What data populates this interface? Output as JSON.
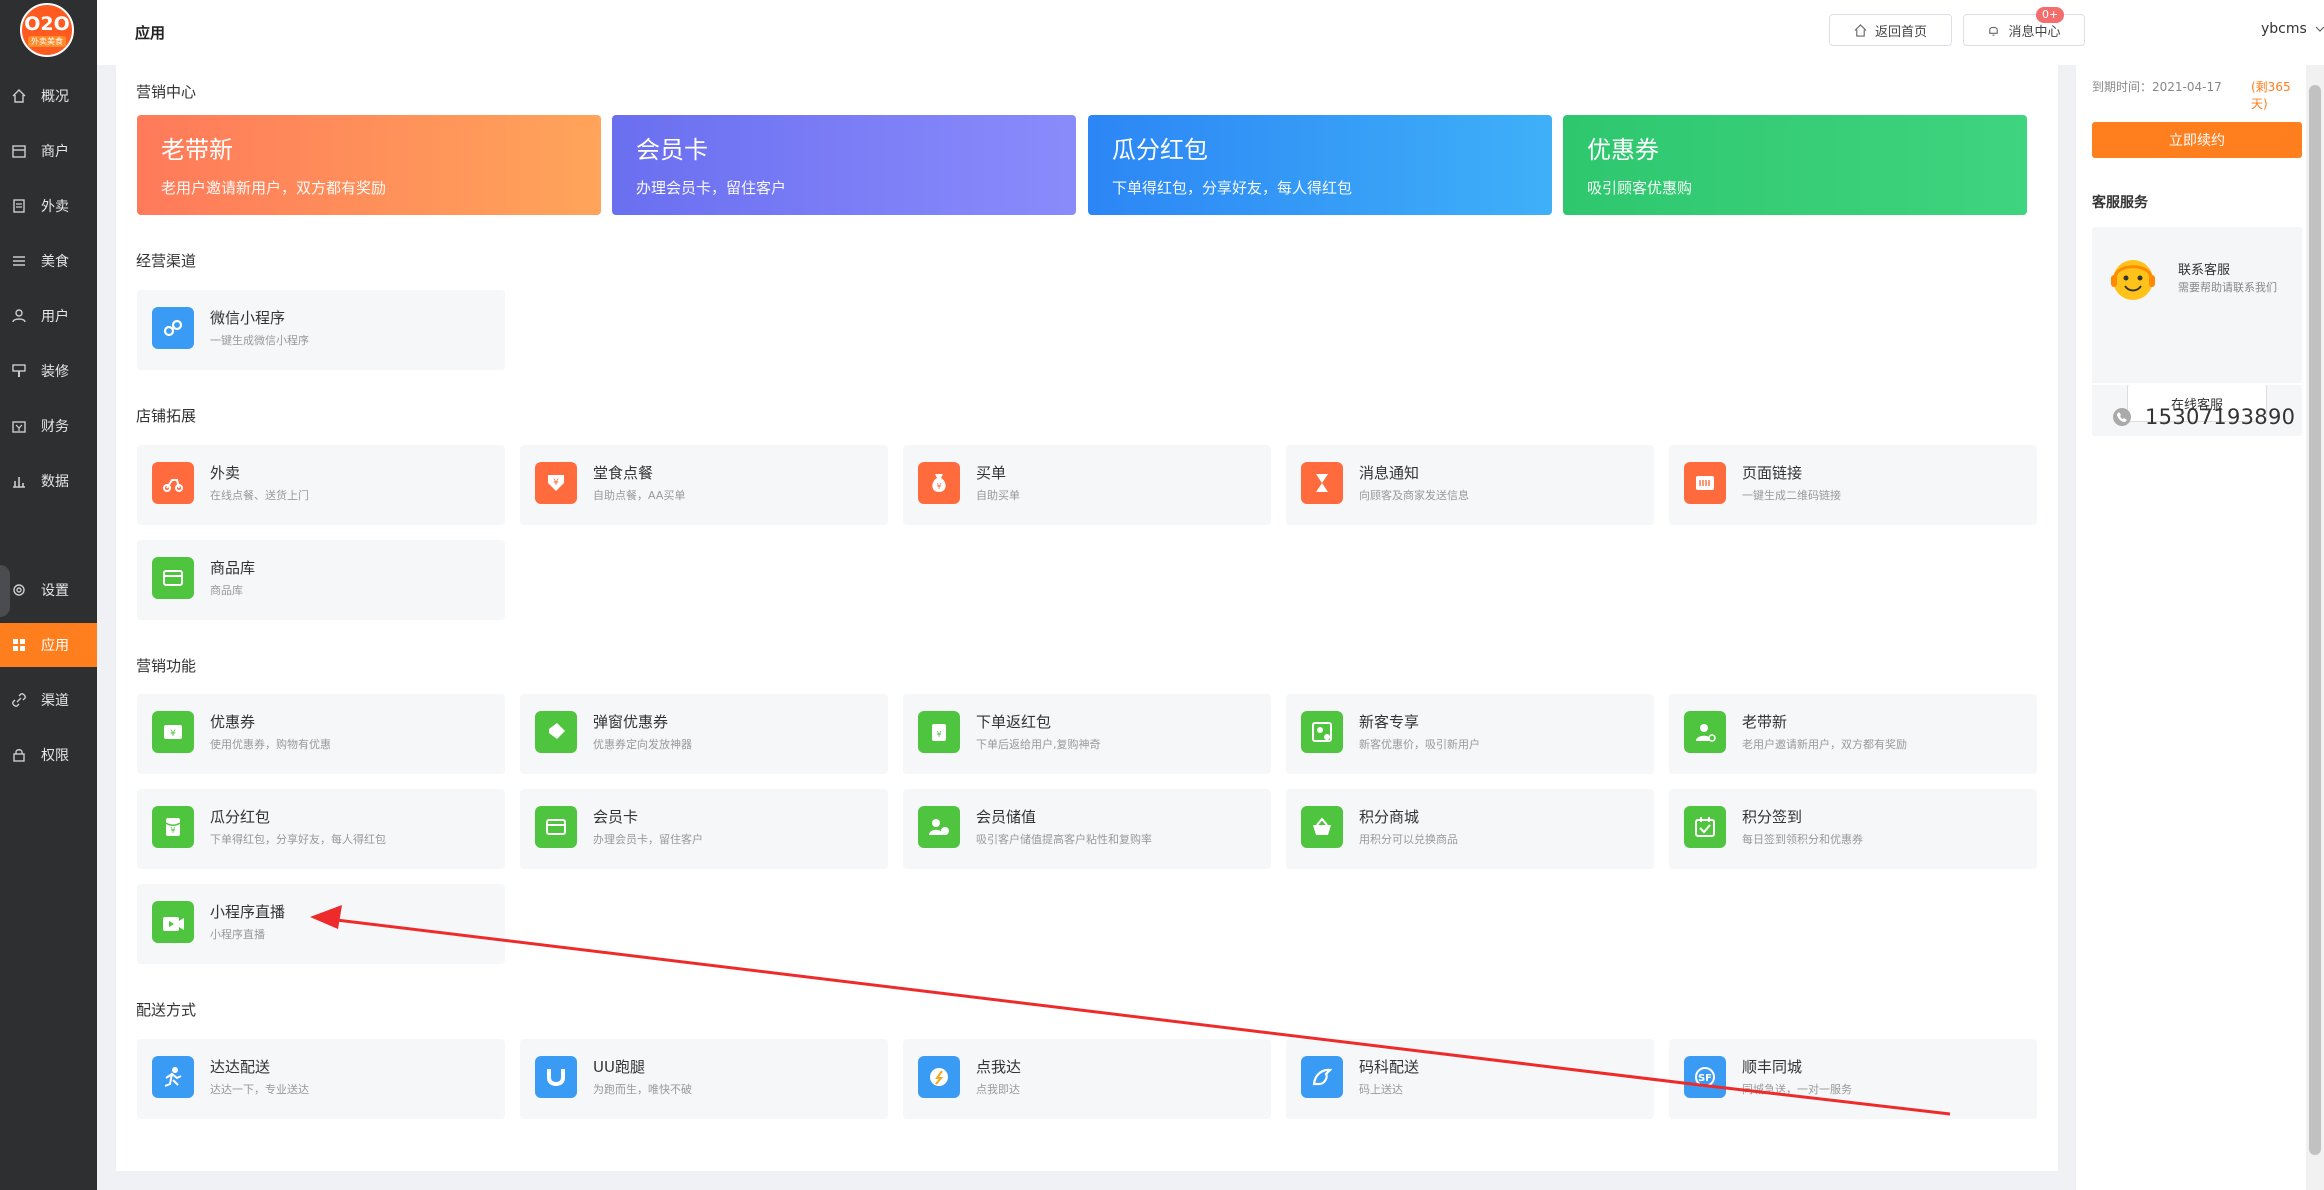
{
  "logo": {
    "text": "O2O",
    "sub": "外卖美食"
  },
  "sidebar": {
    "items": [
      {
        "label": "概况",
        "icon": "home-icon"
      },
      {
        "label": "商户",
        "icon": "store-icon"
      },
      {
        "label": "外卖",
        "icon": "document-icon"
      },
      {
        "label": "美食",
        "icon": "list-icon"
      },
      {
        "label": "用户",
        "icon": "user-icon"
      },
      {
        "label": "装修",
        "icon": "paint-icon"
      },
      {
        "label": "财务",
        "icon": "wallet-icon"
      },
      {
        "label": "数据",
        "icon": "bar-chart-icon"
      },
      {
        "label": "设置",
        "icon": "gear-icon"
      },
      {
        "label": "应用",
        "icon": "apps-icon"
      },
      {
        "label": "渠道",
        "icon": "link-icon"
      },
      {
        "label": "权限",
        "icon": "lock-icon"
      }
    ]
  },
  "header": {
    "title": "应用",
    "home_label": "返回首页",
    "msg_label": "消息中心",
    "msg_badge": "0+",
    "user": "ybcms"
  },
  "sections": {
    "marketing_center": "营销中心",
    "channels": "经营渠道",
    "store_ext": "店铺拓展",
    "marketing_func": "营销功能",
    "delivery": "配送方式"
  },
  "banners": [
    {
      "title": "老带新",
      "desc": "老用户邀请新用户，双方都有奖励"
    },
    {
      "title": "会员卡",
      "desc": "办理会员卡，留住客户"
    },
    {
      "title": "瓜分红包",
      "desc": "下单得红包，分享好友，每人得红包"
    },
    {
      "title": "优惠券",
      "desc": "吸引顾客优惠购"
    }
  ],
  "channels": [
    {
      "title": "微信小程序",
      "desc": "一键生成微信小程序"
    }
  ],
  "store_ext": [
    {
      "title": "外卖",
      "desc": "在线点餐、送货上门"
    },
    {
      "title": "堂食点餐",
      "desc": "自助点餐，AA买单"
    },
    {
      "title": "买单",
      "desc": "自助买单"
    },
    {
      "title": "消息通知",
      "desc": "向顾客及商家发送信息"
    },
    {
      "title": "页面链接",
      "desc": "一键生成二维码链接"
    },
    {
      "title": "商品库",
      "desc": "商品库"
    }
  ],
  "marketing": [
    {
      "title": "优惠券",
      "desc": "使用优惠券，购物有优惠"
    },
    {
      "title": "弹窗优惠券",
      "desc": "优惠券定向发放神器"
    },
    {
      "title": "下单返红包",
      "desc": "下单后返给用户,复购神奇"
    },
    {
      "title": "新客专享",
      "desc": "新客优惠价，吸引新用户"
    },
    {
      "title": "老带新",
      "desc": "老用户邀请新用户，双方都有奖励"
    },
    {
      "title": "瓜分红包",
      "desc": "下单得红包，分享好友，每人得红包"
    },
    {
      "title": "会员卡",
      "desc": "办理会员卡，留住客户"
    },
    {
      "title": "会员储值",
      "desc": "吸引客户储值提高客户粘性和复购率"
    },
    {
      "title": "积分商城",
      "desc": "用积分可以兑换商品"
    },
    {
      "title": "积分签到",
      "desc": "每日签到领积分和优惠券"
    },
    {
      "title": "小程序直播",
      "desc": "小程序直播"
    }
  ],
  "delivery": [
    {
      "title": "达达配送",
      "desc": "达达一下，专业送达"
    },
    {
      "title": "UU跑腿",
      "desc": "为跑而生，唯快不破"
    },
    {
      "title": "点我达",
      "desc": "点我即达"
    },
    {
      "title": "码科配送",
      "desc": "码上送达"
    },
    {
      "title": "顺丰同城",
      "desc": "同城急送，一对一服务"
    }
  ],
  "right": {
    "expire_label": "到期时间：2021-04-17",
    "expire_left": "(剩365天)",
    "renew": "立即续约",
    "service_title": "客服服务",
    "contact": "联系客服",
    "contact_desc": "需要帮助请联系我们",
    "online": "在线客服",
    "phone": "15307193890"
  },
  "colors": {
    "accent": "#ff7e1e",
    "sidebar": "#2e2f31",
    "orange_icon": "#ff6b3d",
    "green_icon": "#4fc43e",
    "blue_icon": "#3a9bf5"
  }
}
